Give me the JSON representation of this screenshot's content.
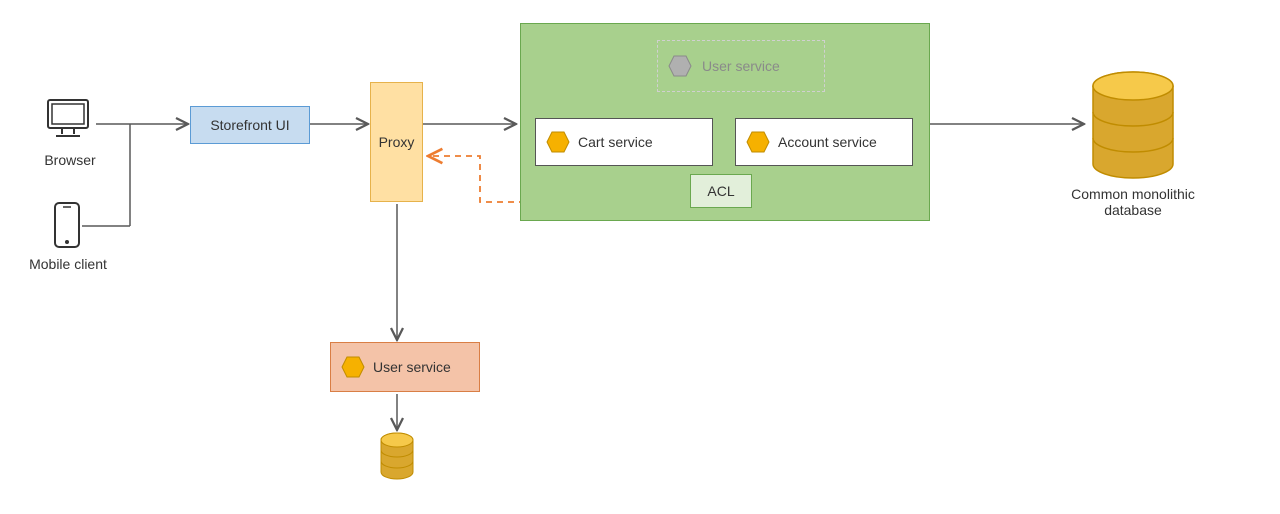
{
  "clients": {
    "browser_label": "Browser",
    "mobile_label": "Mobile client"
  },
  "nodes": {
    "storefront": "Storefront UI",
    "proxy": "Proxy",
    "cart": "Cart service",
    "account": "Account service",
    "user_ghost": "User service",
    "acl": "ACL",
    "user_new": "User service",
    "db_label": "Common monolithic\ndatabase"
  },
  "colors": {
    "arrow_gray": "#595959",
    "arrow_orange": "#ed7d31",
    "hex_fill": "#f6b100",
    "hex_stroke": "#c08c00",
    "hex_ghost_fill": "#b0b0b0",
    "hex_ghost_stroke": "#8a8a8a",
    "db_top": "#f6c94a",
    "db_side": "#d9a72e"
  }
}
